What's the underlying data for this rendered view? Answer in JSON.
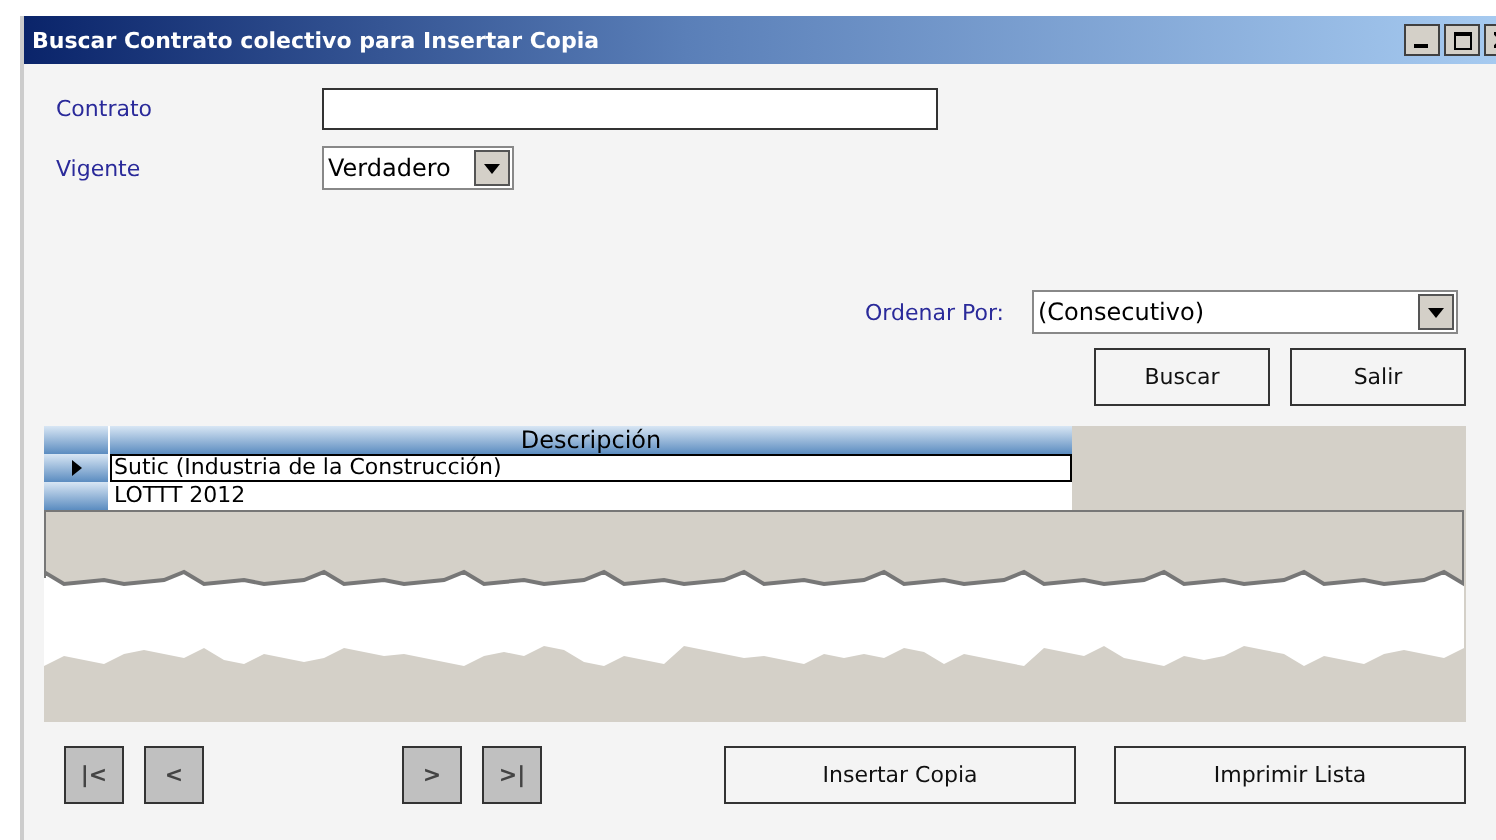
{
  "window": {
    "title": "Buscar Contrato colectivo para Insertar Copia"
  },
  "form": {
    "contrato": {
      "label": "Contrato"
    },
    "vigente": {
      "label": "Vigente",
      "value": "Verdadero"
    },
    "ordenar": {
      "label": "Ordenar Por:",
      "value": "(Consecutivo)"
    }
  },
  "search_buttons": [
    "Buscar",
    "Salir"
  ],
  "grid": {
    "columns": [
      "Descripción"
    ],
    "rows": [
      {
        "text": "Sutic (Industria de la Construcción)",
        "selected": true
      },
      {
        "text": "LOTTT 2012",
        "selected": false
      }
    ]
  },
  "nav_buttons": [
    "|<",
    "<",
    ">",
    ">|"
  ],
  "action_buttons": [
    "Insertar Copia",
    "Imprimir Lista"
  ]
}
